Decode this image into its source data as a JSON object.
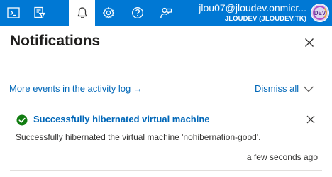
{
  "topbar": {
    "buttons": [
      {
        "icon": "cloud-shell-icon"
      },
      {
        "icon": "directory-filter-icon"
      },
      {
        "icon": "notifications-bell-icon",
        "active": true
      },
      {
        "icon": "settings-gear-icon"
      },
      {
        "icon": "help-icon"
      },
      {
        "icon": "feedback-icon"
      }
    ],
    "account": {
      "email": "jlou07@jloudev.onmicr...",
      "tenant": "JLOUDEV (JLOUDEV.TK)",
      "avatar_text": "DEV"
    },
    "colors": {
      "bar": "#0078d4",
      "active_button_bg": "#ffffff"
    }
  },
  "panel": {
    "title": "Notifications",
    "activity_log_link": "More events in the activity log",
    "activity_log_arrow": "→",
    "dismiss_all_label": "Dismiss all"
  },
  "notifications": [
    {
      "status": "success",
      "title": "Successfully hibernated virtual machine",
      "message": "Successfully hibernated the virtual machine 'nohibernation-good'.",
      "time": "a few seconds ago"
    }
  ],
  "colors": {
    "link": "#0067b8",
    "success": "#107c10"
  }
}
